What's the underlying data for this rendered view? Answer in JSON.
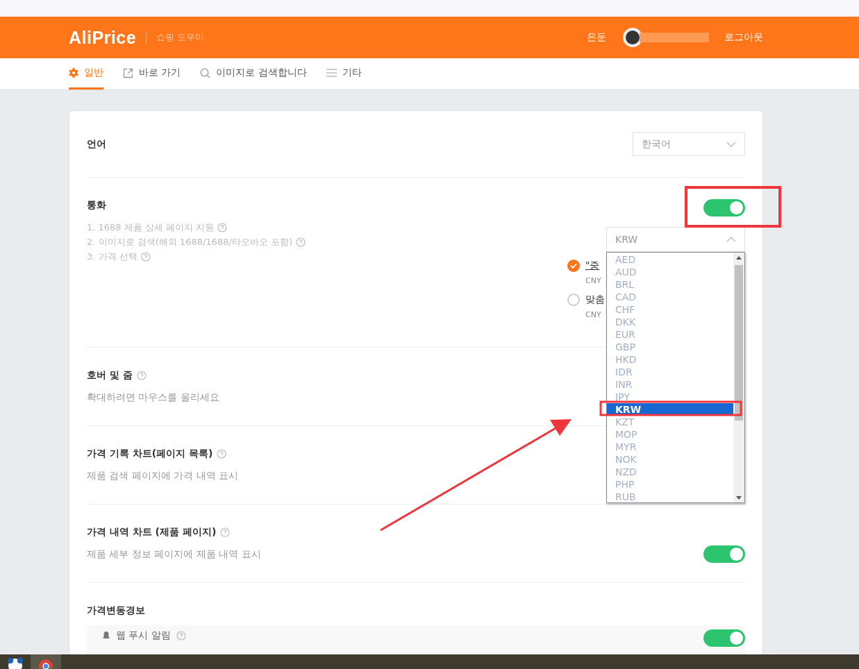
{
  "header": {
    "logo": "AliPrice",
    "tagline": "쇼핑 도우미",
    "user_name": "은둔",
    "logout": "로그아웃"
  },
  "tabs": [
    {
      "label": "일반",
      "selected": true
    },
    {
      "label": "바로 가기",
      "selected": false
    },
    {
      "label": "이미지로 검색합니다",
      "selected": false
    },
    {
      "label": "기타",
      "selected": false
    }
  ],
  "settings": [
    {
      "kind": "select",
      "title": "언어",
      "value": "한국어"
    },
    {
      "kind": "currency",
      "title": "통화",
      "on": true,
      "notes": [
        "1. 1688 제품 상세 페이지 지원",
        "2. 이미지로 검색(해외 1688/1688/타오바오 포함)",
        "3. 가격 선택"
      ],
      "options": [
        {
          "label": "\"중",
          "sub": "CNY",
          "selected": true
        },
        {
          "label": "맞춤",
          "sub": "CNY",
          "selected": false
        }
      ],
      "currency_select": {
        "value": "KRW",
        "expanded": true,
        "options": [
          {
            "label": "AED",
            "selected": false
          },
          {
            "label": "AUD",
            "selected": false
          },
          {
            "label": "BRL",
            "selected": false
          },
          {
            "label": "CAD",
            "selected": false
          },
          {
            "label": "CHF",
            "selected": false
          },
          {
            "label": "DKK",
            "selected": false
          },
          {
            "label": "EUR",
            "selected": false
          },
          {
            "label": "GBP",
            "selected": false
          },
          {
            "label": "HKD",
            "selected": false
          },
          {
            "label": "IDR",
            "selected": false
          },
          {
            "label": "INR",
            "selected": false
          },
          {
            "label": "JPY",
            "selected": false
          },
          {
            "label": "KRW",
            "selected": true
          },
          {
            "label": "KZT",
            "selected": false
          },
          {
            "label": "MOP",
            "selected": false
          },
          {
            "label": "MYR",
            "selected": false
          },
          {
            "label": "NOK",
            "selected": false
          },
          {
            "label": "NZD",
            "selected": false
          },
          {
            "label": "PHP",
            "selected": false
          },
          {
            "label": "RUB",
            "selected": false
          }
        ]
      }
    },
    {
      "kind": "info",
      "title": "호버 및 줌",
      "desc": "확대하려면 마우스를 올리세요"
    },
    {
      "kind": "info",
      "title": "가격 기록 차트(페이지 목록)",
      "desc": "제품 검색 페이지에 가격 내역 표시"
    },
    {
      "kind": "toggle",
      "title": "가격 내역 차트 (제품 페이지)",
      "desc": "제품 세부 정보 페이지에 제품 내역 표시",
      "on": true
    },
    {
      "kind": "group",
      "title": "가격변동경보",
      "items": [
        {
          "label": "웹 푸시 알림",
          "on": true
        }
      ]
    }
  ],
  "annotations": [
    {
      "kind": "box"
    },
    {
      "kind": "box"
    },
    {
      "kind": "arrow"
    }
  ]
}
